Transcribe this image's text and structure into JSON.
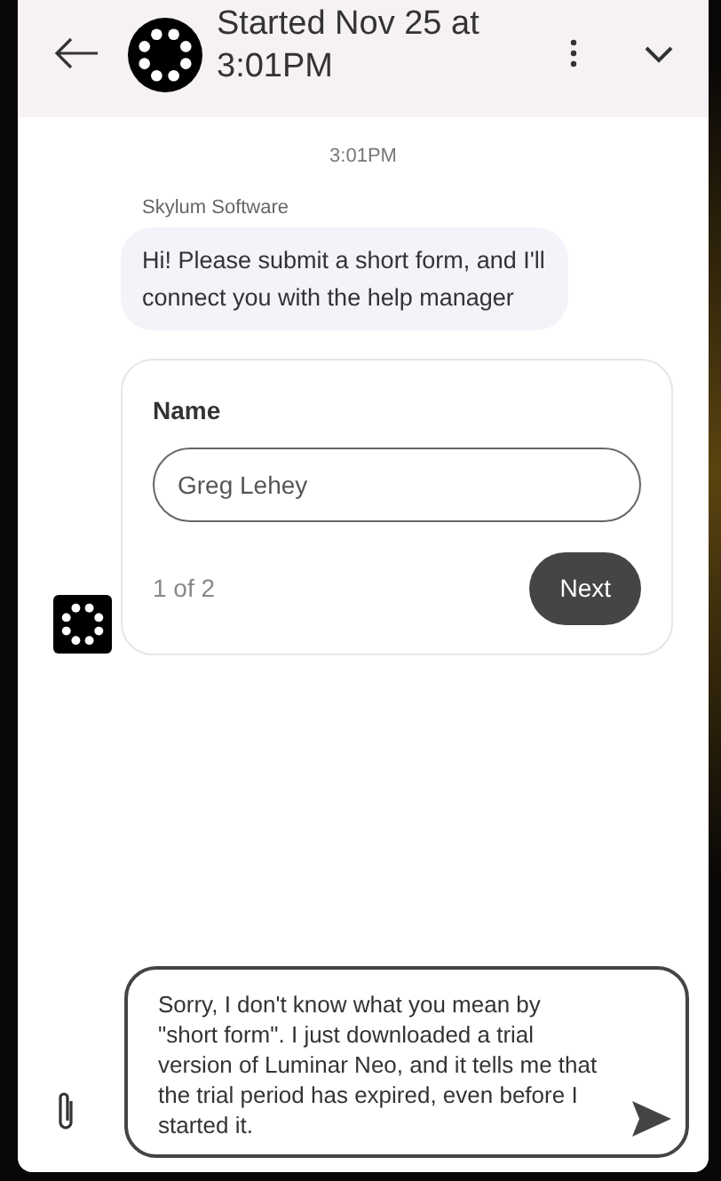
{
  "header": {
    "title": "Started Nov 25 at 3:01PM"
  },
  "timestamp": "3:01PM",
  "messages": [
    {
      "sender": "Skylum Software",
      "text": "Hi! Please submit a short form, and I'll connect you with the help manager"
    }
  ],
  "form": {
    "label": "Name",
    "value": "Greg Lehey",
    "step": "1 of 2",
    "button": "Next"
  },
  "composer": {
    "value": "Sorry, I don't know what you mean by \"short form\".  I just downloaded a trial version of Luminar Neo, and it tells me that the trial period has expired, even before I started it."
  }
}
